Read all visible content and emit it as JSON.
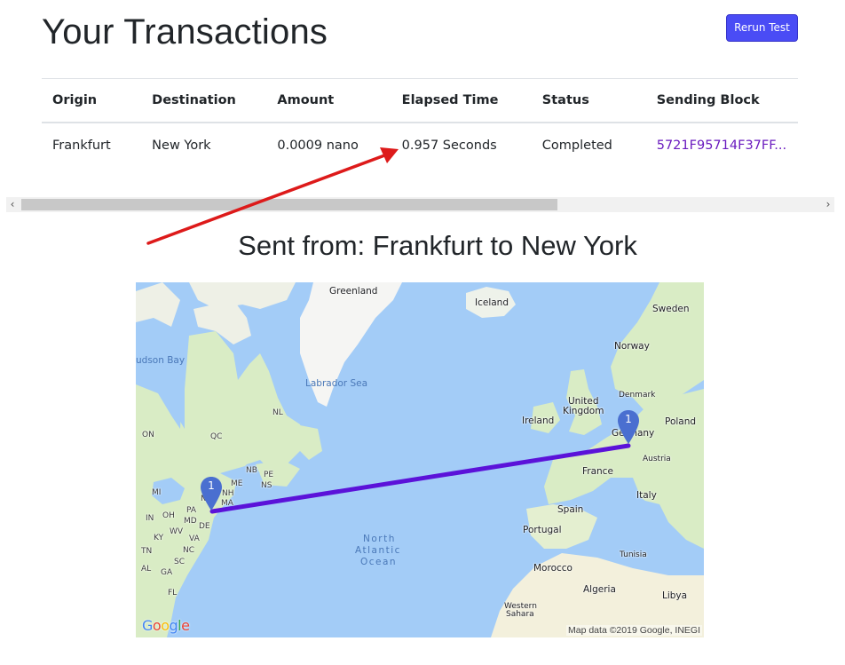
{
  "header": {
    "title": "Your Transactions",
    "rerun_button": "Rerun Test"
  },
  "colors": {
    "button_bg": "#4a4cf5",
    "link": "#6a1bbf",
    "route": "#5b12d9",
    "marker": "#4a6fd0",
    "annotation_arrow": "#dd1a1a",
    "water": "#a3ccf7"
  },
  "table": {
    "columns": [
      "Origin",
      "Destination",
      "Amount",
      "Elapsed Time",
      "Status",
      "Sending Block"
    ],
    "rows": [
      {
        "origin": "Frankfurt",
        "destination": "New York",
        "amount": "0.0009 nano",
        "elapsed_time": "0.957 Seconds",
        "status": "Completed",
        "sending_block": "5721F95714F37FF..."
      }
    ]
  },
  "scrollbar": {
    "left_arrow": "‹",
    "right_arrow": "›",
    "position_fraction": 0.0,
    "visible_fraction": 0.65
  },
  "map_section": {
    "title": "Sent from: Frankfurt to New York",
    "markers": [
      {
        "label": "1",
        "place": "New York"
      },
      {
        "label": "1",
        "place": "Frankfurt"
      }
    ],
    "labels": {
      "greenland": "Greenland",
      "iceland": "Iceland",
      "sweden": "Sweden",
      "norway": "Norway",
      "hudson_bay": "udson Bay",
      "labrador_sea": "Labrador Sea",
      "nl": "NL",
      "on": "ON",
      "qc": "QC",
      "nb": "NB",
      "pe": "PE",
      "ns": "NS",
      "me": "ME",
      "nh": "NH",
      "ma": "MA",
      "ny": "N",
      "mi": "MI",
      "in": "IN",
      "oh": "OH",
      "pa": "PA",
      "md": "MD",
      "de": "DE",
      "wv": "WV",
      "ky": "KY",
      "va": "VA",
      "tn": "TN",
      "nc": "NC",
      "sc": "SC",
      "al": "AL",
      "ga": "GA",
      "fl": "FL",
      "north_atlantic_1": "North",
      "north_atlantic_2": "Atlantic",
      "north_atlantic_3": "Ocean",
      "denmark": "Denmark",
      "united_kingdom_1": "United",
      "united_kingdom_2": "Kingdom",
      "ireland": "Ireland",
      "germany": "Germany",
      "poland": "Poland",
      "france": "France",
      "austria": "Austria",
      "italy": "Italy",
      "spain": "Spain",
      "portugal": "Portugal",
      "tunisia": "Tunisia",
      "morocco": "Morocco",
      "algeria": "Algeria",
      "libya": "Libya",
      "western_sahara_1": "Western",
      "western_sahara_2": "Sahara"
    },
    "google_logo": [
      "G",
      "o",
      "o",
      "g",
      "l",
      "e"
    ],
    "attribution": "Map data ©2019 Google, INEGI"
  }
}
